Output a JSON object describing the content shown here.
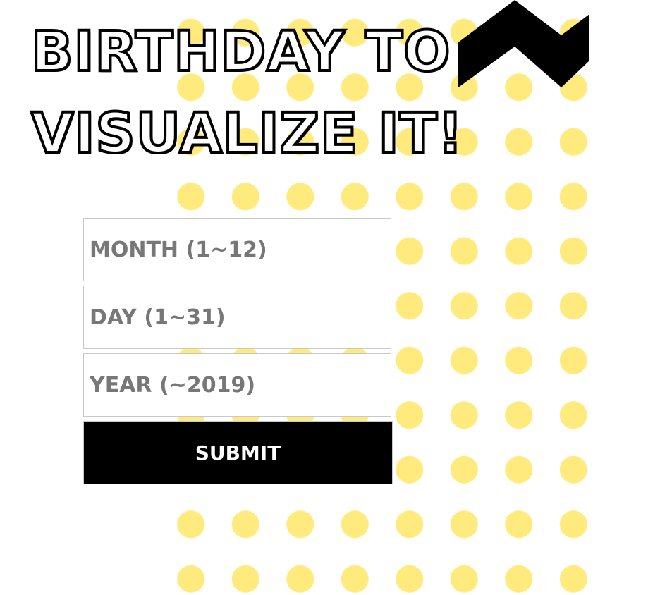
{
  "header": {
    "title_lines": [
      "BIRTHDAY TO",
      "VISUALIZE IT!"
    ]
  },
  "logo": {
    "icon": "zigzag-chevron-icon",
    "color": "#000000"
  },
  "background": {
    "dot_color": "#ffeb7d",
    "base_color": "#ffffff"
  },
  "form": {
    "month_placeholder": "MONTH (1~12)",
    "month_value": "",
    "day_placeholder": "DAY (1~31)",
    "day_value": "",
    "year_placeholder": "YEAR (~2019)",
    "year_value": "",
    "submit_label": "SUBMIT"
  }
}
